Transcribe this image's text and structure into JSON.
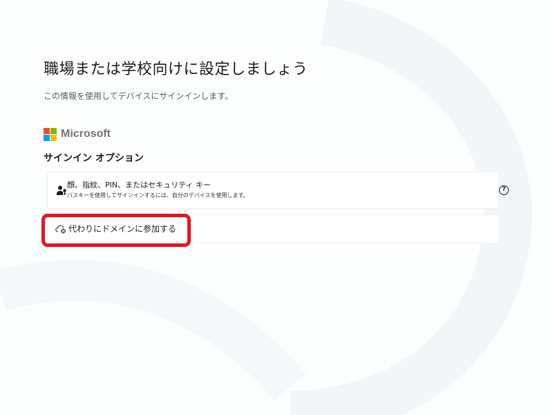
{
  "page": {
    "title": "職場または学校向けに設定しましょう",
    "subtitle": "この情報を使用してデバイスにサインインします。"
  },
  "brand": {
    "name": "Microsoft",
    "logo_colors": [
      "#f25022",
      "#7fba00",
      "#00a4ef",
      "#ffb900"
    ]
  },
  "signin_options": {
    "heading": "サインイン オプション",
    "options": [
      {
        "label": "顔、指紋、PIN、またはセキュリティ キー",
        "description": "パスキーを使用してサインインするには、自分のデバイスを使用します。",
        "icon": "person-key-icon",
        "help_icon": "help-icon",
        "help_glyph": "?"
      }
    ]
  },
  "domain_join": {
    "label": "代わりにドメインに参加する",
    "icon": "cloud-gear-icon"
  },
  "colors": {
    "highlight": "#e8121c",
    "text_primary": "#1b1b1b",
    "text_secondary": "#505a66"
  }
}
